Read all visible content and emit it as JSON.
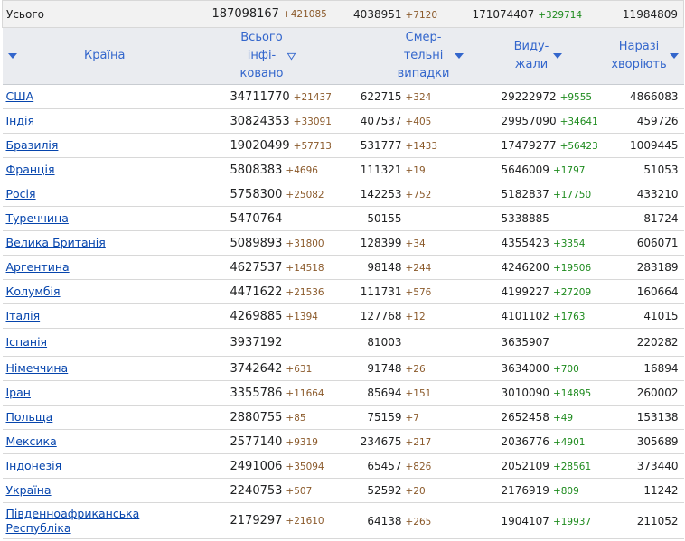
{
  "totals": {
    "label": "Усього",
    "cases": "187098167",
    "cases_delta": "+421085",
    "deaths": "4038951",
    "deaths_delta": "+7120",
    "recovered": "171074407",
    "recovered_delta": "+329714",
    "active": "11984809"
  },
  "headers": {
    "country": "Країна",
    "cases": [
      "Всього",
      "інфі-",
      "ковано"
    ],
    "deaths": [
      "Смер-",
      "тельні",
      "випадки"
    ],
    "recovered": [
      "Виду-",
      "жали"
    ],
    "active": [
      "Наразі",
      "хворіють"
    ]
  },
  "colors": {
    "link": "#0645ad",
    "header_text": "#3366cc",
    "delta_cases": "#8b5a2b",
    "delta_recovered": "#1e8b1e"
  },
  "rows": [
    {
      "country": "США",
      "cases": "34711770",
      "cases_delta": "+21437",
      "deaths": "622715",
      "deaths_delta": "+324",
      "recovered": "29222972",
      "recovered_delta": "+9555",
      "active": "4866083"
    },
    {
      "country": "Індія",
      "cases": "30824353",
      "cases_delta": "+33091",
      "deaths": "407537",
      "deaths_delta": "+405",
      "recovered": "29957090",
      "recovered_delta": "+34641",
      "active": "459726"
    },
    {
      "country": "Бразилія",
      "cases": "19020499",
      "cases_delta": "+57713",
      "deaths": "531777",
      "deaths_delta": "+1433",
      "recovered": "17479277",
      "recovered_delta": "+56423",
      "active": "1009445"
    },
    {
      "country": "Франція",
      "cases": "5808383",
      "cases_delta": "+4696",
      "deaths": "111321",
      "deaths_delta": "+19",
      "recovered": "5646009",
      "recovered_delta": "+1797",
      "active": "51053"
    },
    {
      "country": "Росія",
      "cases": "5758300",
      "cases_delta": "+25082",
      "deaths": "142253",
      "deaths_delta": "+752",
      "recovered": "5182837",
      "recovered_delta": "+17750",
      "active": "433210"
    },
    {
      "country": "Туреччина",
      "cases": "5470764",
      "cases_delta": "",
      "deaths": "50155",
      "deaths_delta": "",
      "recovered": "5338885",
      "recovered_delta": "",
      "active": "81724"
    },
    {
      "country": "Велика Британія",
      "cases": "5089893",
      "cases_delta": "+31800",
      "deaths": "128399",
      "deaths_delta": "+34",
      "recovered": "4355423",
      "recovered_delta": "+3354",
      "active": "606071"
    },
    {
      "country": "Аргентина",
      "cases": "4627537",
      "cases_delta": "+14518",
      "deaths": "98148",
      "deaths_delta": "+244",
      "recovered": "4246200",
      "recovered_delta": "+19506",
      "active": "283189"
    },
    {
      "country": "Колумбія",
      "cases": "4471622",
      "cases_delta": "+21536",
      "deaths": "111731",
      "deaths_delta": "+576",
      "recovered": "4199227",
      "recovered_delta": "+27209",
      "active": "160664"
    },
    {
      "country": "Італія",
      "cases": "4269885",
      "cases_delta": "+1394",
      "deaths": "127768",
      "deaths_delta": "+12",
      "recovered": "4101102",
      "recovered_delta": "+1763",
      "active": "41015"
    },
    {
      "country": "Іспанія",
      "cases": "3937192",
      "cases_delta": "",
      "deaths": "81003",
      "deaths_delta": "",
      "recovered": "3635907",
      "recovered_delta": "",
      "active": "220282"
    },
    {
      "country": "Німеччина",
      "cases": "3742642",
      "cases_delta": "+631",
      "deaths": "91748",
      "deaths_delta": "+26",
      "recovered": "3634000",
      "recovered_delta": "+700",
      "active": "16894"
    },
    {
      "country": "Іран",
      "cases": "3355786",
      "cases_delta": "+11664",
      "deaths": "85694",
      "deaths_delta": "+151",
      "recovered": "3010090",
      "recovered_delta": "+14895",
      "active": "260002"
    },
    {
      "country": "Польща",
      "cases": "2880755",
      "cases_delta": "+85",
      "deaths": "75159",
      "deaths_delta": "+7",
      "recovered": "2652458",
      "recovered_delta": "+49",
      "active": "153138"
    },
    {
      "country": "Мексика",
      "cases": "2577140",
      "cases_delta": "+9319",
      "deaths": "234675",
      "deaths_delta": "+217",
      "recovered": "2036776",
      "recovered_delta": "+4901",
      "active": "305689"
    },
    {
      "country": "Індонезія",
      "cases": "2491006",
      "cases_delta": "+35094",
      "deaths": "65457",
      "deaths_delta": "+826",
      "recovered": "2052109",
      "recovered_delta": "+28561",
      "active": "373440"
    },
    {
      "country": "Україна",
      "cases": "2240753",
      "cases_delta": "+507",
      "deaths": "52592",
      "deaths_delta": "+20",
      "recovered": "2176919",
      "recovered_delta": "+809",
      "active": "11242"
    },
    {
      "country": "Південноафриканська Республіка",
      "country_lines": [
        "Південноафриканська",
        "Республіка"
      ],
      "cases": "2179297",
      "cases_delta": "+21610",
      "deaths": "64138",
      "deaths_delta": "+265",
      "recovered": "1904107",
      "recovered_delta": "+19937",
      "active": "211052"
    }
  ]
}
